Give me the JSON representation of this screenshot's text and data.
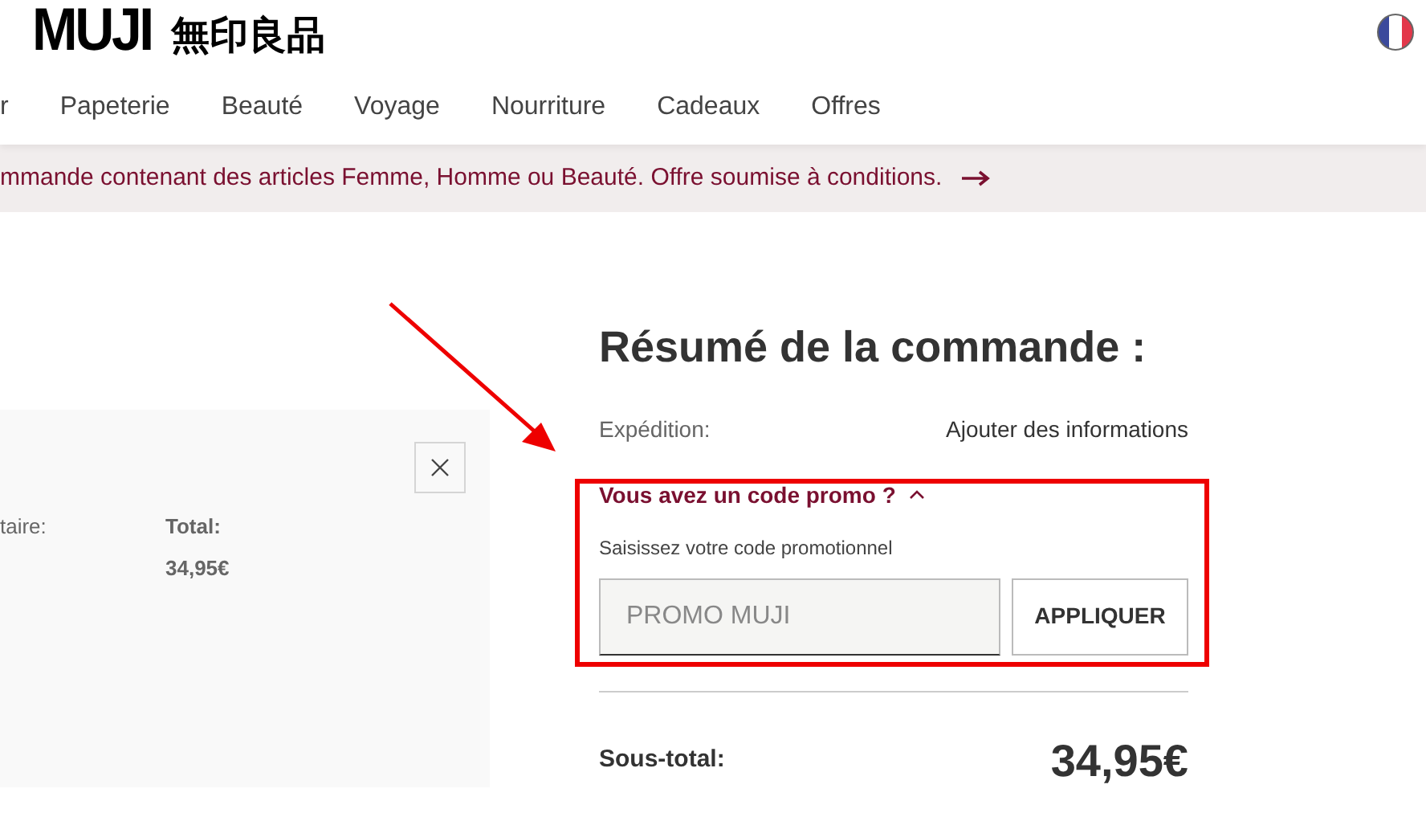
{
  "header": {
    "logo": {
      "latin": "MUJI",
      "kanji": "無印良品"
    },
    "nav": [
      "r",
      "Papeterie",
      "Beauté",
      "Voyage",
      "Nourriture",
      "Cadeaux",
      "Offres"
    ]
  },
  "banner": {
    "text": "mmande contenant des articles Femme, Homme ou Beauté. Offre soumise à conditions."
  },
  "cart_item": {
    "column_1": "taire:",
    "total_label": "Total:",
    "total_value": "34,95€"
  },
  "summary": {
    "title": "Résumé de la commande :",
    "shipping_label": "Expédition:",
    "shipping_link": "Ajouter des informations",
    "promo": {
      "toggle": "Vous avez un code promo ?",
      "expanded": true,
      "label": "Saisissez votre code promotionnel",
      "placeholder": "PROMO MUJI",
      "button": "APPLIQUER"
    },
    "subtotal_label": "Sous-total:",
    "subtotal_value": "34,95€"
  }
}
